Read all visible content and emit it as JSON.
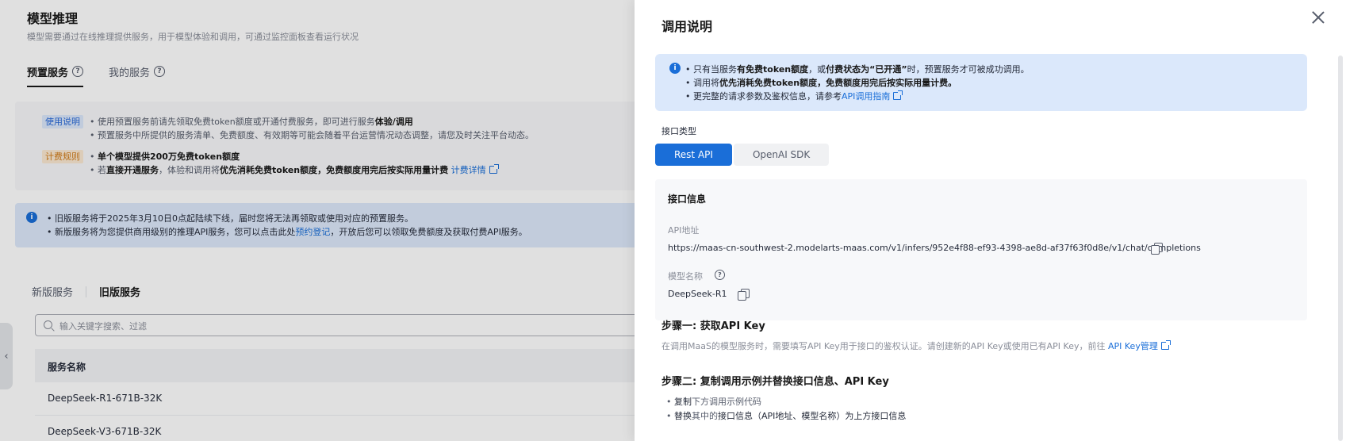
{
  "background": {
    "title": "模型推理",
    "subtitle": "模型需要通过在线推理提供服务，用于模型体验和调用，可通过监控面板查看运行状况",
    "tabs": [
      {
        "label": "预置服务",
        "active": true
      },
      {
        "label": "我的服务",
        "active": false
      }
    ],
    "notice": {
      "usage_tag": "使用说明",
      "usage_line1_a": "使用预置服务前请先领取免费token额度或开通付费服务，即可进行服务",
      "usage_line1_b": "体验/调用",
      "usage_line2": "预置服务中所提供的服务清单、免费额度、有效期等可能会随着平台运营情况动态调整，请您及时关注平台动态。",
      "billing_tag": "计费规则",
      "billing_line1": "单个模型提供200万免费token额度",
      "billing_line2_a": "若",
      "billing_line2_b": "直接开通服务",
      "billing_line2_c": "，体验和调用将",
      "billing_line2_d": "优先消耗免费token额度，免费额度用完后按实际用量计费",
      "billing_link": "计费详情"
    },
    "alert": {
      "line1": "旧版服务将于2025年3月10日0点起陆续下线，届时您将无法再领取或使用对应的预置服务。",
      "line2_a": "新版服务将为您提供商用级别的推理API服务，您可以点击此处",
      "line2_link": "预约登记",
      "line2_b": "，开放后您可以领取免费额度及获取付费API服务。"
    },
    "subtabs": [
      {
        "label": "新版服务",
        "active": false
      },
      {
        "label": "旧版服务",
        "active": true
      }
    ],
    "search_placeholder": "输入关键字搜索、过滤",
    "table": {
      "header": "服务名称",
      "rows": [
        "DeepSeek-R1-671B-32K",
        "DeepSeek-V3-671B-32K"
      ]
    }
  },
  "drawer": {
    "title": "调用说明",
    "alert": {
      "line1_a": "只有当服务",
      "line1_b": "有免费token额度",
      "line1_c": "，或",
      "line1_d": "付费状态为“已开通”",
      "line1_e": "时，预置服务才可被成功调用。",
      "line2_a": "调用将",
      "line2_b": "优先消耗免费token额度，免费额度用完后按实际用量计费。",
      "line3_a": "更完整的请求参数及鉴权信息，请参考",
      "line3_link": "API调用指南"
    },
    "interface_type_label": "接口类型",
    "interface_options": [
      {
        "label": "Rest API",
        "active": true
      },
      {
        "label": "OpenAI SDK",
        "active": false
      }
    ],
    "interface_info": {
      "header": "接口信息",
      "api_label": "API地址",
      "api_value": "https://maas-cn-southwest-2.modelarts-maas.com/v1/infers/952e4f88-ef93-4398-ae8d-af37f63f0d8e/v1/chat/completions",
      "model_label": "模型名称",
      "model_value": "DeepSeek-R1"
    },
    "step1": {
      "title": "步骤一: 获取API Key",
      "desc": "在调用MaaS的模型服务时，需要填写API Key用于接口的鉴权认证。请创建新的API Key或使用已有API Key，前往",
      "link": "API Key管理"
    },
    "step2": {
      "title": "步骤二: 复制调用示例并替换接口信息、API Key",
      "bullet1_a": "复制",
      "bullet1_b": "下方调用示例代码",
      "bullet2_a": "替换",
      "bullet2_b": "其中的",
      "bullet2_c": "接口信息（API地址、模型名称）为上方接口信息"
    }
  }
}
